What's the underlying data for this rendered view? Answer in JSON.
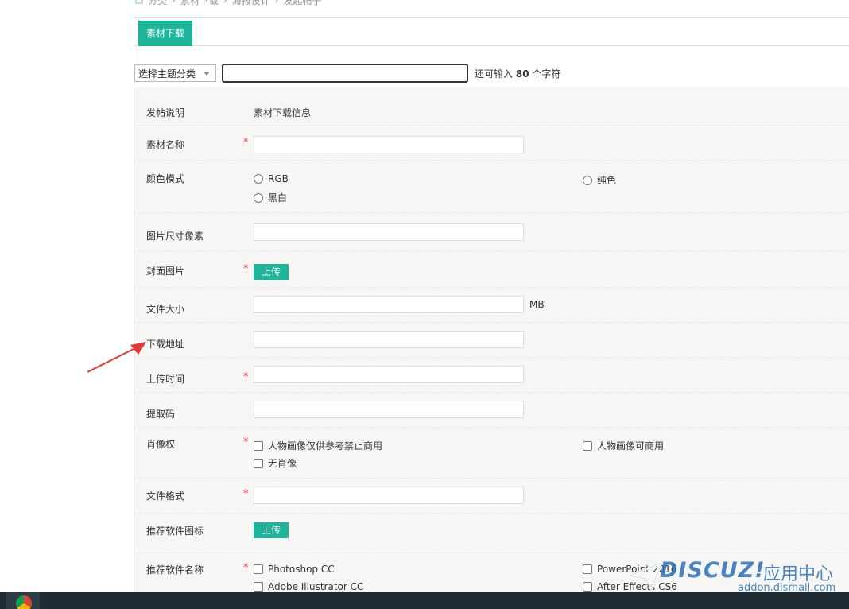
{
  "breadcrumb": {
    "items": [
      "分类",
      "素材下载",
      "海报设计",
      "发起帖子"
    ]
  },
  "tabs": [
    {
      "label": "素材下载"
    }
  ],
  "subject": {
    "type_select": "选择主题分类",
    "remain_prefix": "还可输入",
    "remain_count": "80",
    "remain_suffix": "个字符"
  },
  "form": {
    "post_note": {
      "label": "发帖说明",
      "value": "素材下载信息"
    },
    "name": {
      "label": "素材名称"
    },
    "color_mode": {
      "label": "颜色模式",
      "options": [
        "RGB",
        "纯色",
        "黑白"
      ]
    },
    "pixel_size": {
      "label": "图片尺寸像素"
    },
    "cover": {
      "label": "封面图片",
      "button": "上传"
    },
    "file_size": {
      "label": "文件大小",
      "unit": "MB"
    },
    "download_url": {
      "label": "下载地址"
    },
    "upload_time": {
      "label": "上传时间"
    },
    "extract_code": {
      "label": "提取码"
    },
    "portrait": {
      "label": "肖像权",
      "options": [
        "人物画像仅供参考禁止商用",
        "人物画像可商用",
        "无肖像"
      ]
    },
    "file_format": {
      "label": "文件格式"
    },
    "software_icon": {
      "label": "推荐软件图标",
      "button": "上传"
    },
    "software_name": {
      "label": "推荐软件名称",
      "options": [
        "Photoshop CC",
        "PowerPoint 2016",
        "Adobe Illustrator CC",
        "After Effects CS6"
      ]
    }
  },
  "required_mark": "*",
  "watermark": {
    "brand": "DISCUZ!",
    "cn": "应用中心",
    "domain": "addon.dismall.com"
  },
  "colors": {
    "accent": "#1db69a",
    "required": "#e33333",
    "arrow": "#e53935"
  }
}
